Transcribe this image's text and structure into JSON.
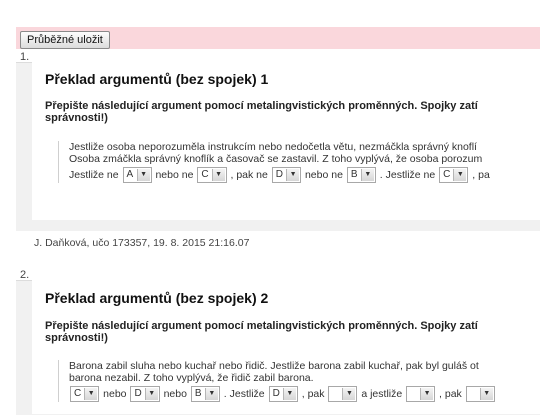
{
  "toolbar": {
    "save_label": "Průběžné uložit"
  },
  "arrow_glyph": "▼",
  "questions": [
    {
      "number": "1.",
      "title": "Překlad argumentů (bez spojek) 1",
      "instruction": "Přepište následující argument pomocí metalingvistických proměnných. Spojky zatí správnosti!)",
      "text_line1": "Jestliže osoba neporozuměla instrukcím nebo nedočetla větu, nezmáčkla správný knoflí",
      "text_line2": "Osoba zmáčkla správný knoflík a časovač se zastavil. Z toho vyplývá, že osoba porozum",
      "answer": {
        "w1": "Jestliže ne",
        "s1": "A",
        "w2": "nebo ne",
        "s2": "C",
        "w3": ", pak ne",
        "s3": "D",
        "w4": "nebo ne",
        "s4": "B",
        "w5": ". Jestliže ne",
        "s5": "C",
        "w6": ", pa"
      },
      "footer": "J. Daňková, učo 173357, 19. 8. 2015 21:16.07"
    },
    {
      "number": "2.",
      "title": "Překlad argumentů (bez spojek) 2",
      "instruction": "Přepište následující argument pomocí metalingvistických proměnných. Spojky zatí správnosti!)",
      "text_line1": "Barona zabil sluha nebo kuchař nebo řidič. Jestliže barona zabil kuchař, pak byl guláš ot",
      "text_line2": "barona nezabil. Z toho vyplývá, že řidič zabil barona.",
      "answer": {
        "s1": "C",
        "w1": "nebo",
        "s2": "D",
        "w2": "nebo",
        "s3": "B",
        "w3": ". Jestliže",
        "s4": "D",
        "w4": ", pak",
        "s5": "",
        "w5": "a jestliže",
        "s6": "",
        "w6": ", pak",
        "s7": ""
      }
    }
  ]
}
